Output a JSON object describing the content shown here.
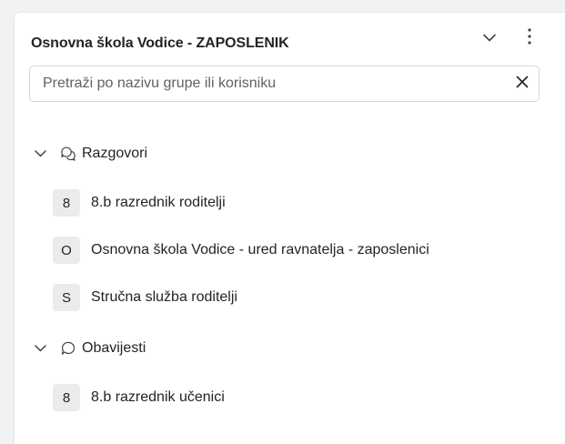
{
  "header": {
    "title": "Osnovna škola Vodice - ZAPOSLENIK",
    "collapse_icon": "chevron-down-icon",
    "more_icon": "more-vertical-icon"
  },
  "search": {
    "placeholder": "Pretraži po nazivu grupe ili korisniku",
    "value": "",
    "clear_icon": "close-icon"
  },
  "sections": [
    {
      "label": "Razgovori",
      "icon": "chat-multiple-icon",
      "expanded": true,
      "items": [
        {
          "initial": "8",
          "label": "8.b razrednik roditelji"
        },
        {
          "initial": "O",
          "label": "Osnovna škola Vodice - ured ravnatelja - zaposlenici"
        },
        {
          "initial": "S",
          "label": "Stručna služba roditelji"
        }
      ]
    },
    {
      "label": "Obavijesti",
      "icon": "chat-icon",
      "expanded": true,
      "items": [
        {
          "initial": "8",
          "label": "8.b razrednik učenici"
        }
      ]
    }
  ],
  "colors": {
    "text": "#242424",
    "avatar_bg": "#ebebeb",
    "page_bg": "#f1f2f4"
  }
}
